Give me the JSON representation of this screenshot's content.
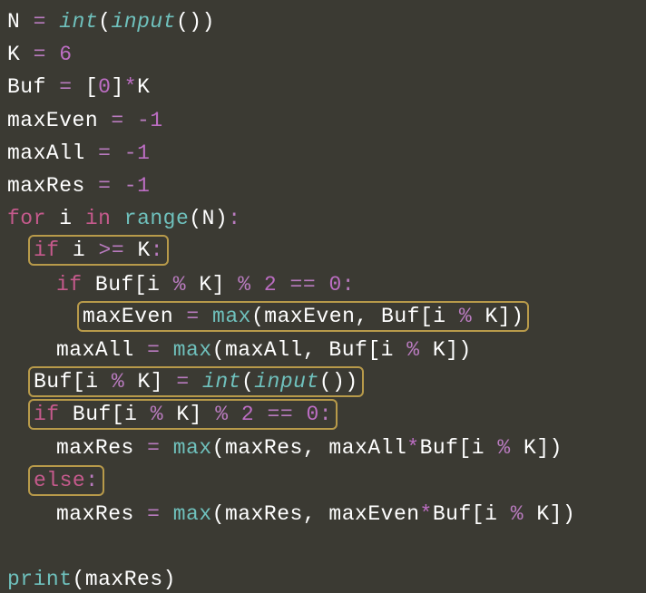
{
  "code": {
    "l1": {
      "a": "N ",
      "op1": "=",
      "b": " ",
      "fn": "int",
      "p1": "(",
      "fn2": "input",
      "p2": "(",
      "p3": ")",
      "p4": ")"
    },
    "l2": {
      "a": "K ",
      "op1": "=",
      "b": " ",
      "n": "6"
    },
    "l3": {
      "a": "Buf ",
      "op1": "=",
      "b": " ",
      "p1": "[",
      "n1": "0",
      "p2": "]",
      "star": "*",
      "c": "K"
    },
    "l4": {
      "a": "maxEven ",
      "op1": "=",
      "b": " ",
      "op2": "-",
      "n": "1"
    },
    "l5": {
      "a": "maxAll ",
      "op1": "=",
      "b": " ",
      "op2": "-",
      "n": "1"
    },
    "l6": {
      "a": "maxRes ",
      "op1": "=",
      "b": " ",
      "op2": "-",
      "n": "1"
    },
    "l7": {
      "kw1": "for",
      "a": " i ",
      "kw2": "in",
      "b": " ",
      "fn": "range",
      "p1": "(",
      "c": "N",
      "p2": ")",
      "col": ":"
    },
    "l8": {
      "kw": "if",
      "a": " i ",
      "op": ">=",
      "b": " K",
      "col": ":"
    },
    "l9": {
      "kw": "if",
      "a": " Buf",
      "p1": "[",
      "b": "i ",
      "op1": "%",
      "c": " K",
      "p2": "]",
      "d": " ",
      "op2": "%",
      "e": " ",
      "n1": "2",
      "f": " ",
      "op3": "==",
      "g": " ",
      "n2": "0",
      "col": ":"
    },
    "l10": {
      "a": "maxEven ",
      "op1": "=",
      "b": " ",
      "fn": "max",
      "p1": "(",
      "c": "maxEven",
      "cm": ",",
      "d": " Buf",
      "p2": "[",
      "e": "i ",
      "op2": "%",
      "f": " K",
      "p3": "]",
      "p4": ")"
    },
    "l11": {
      "a": "maxAll ",
      "op1": "=",
      "b": " ",
      "fn": "max",
      "p1": "(",
      "c": "maxAll",
      "cm": ",",
      "d": " Buf",
      "p2": "[",
      "e": "i ",
      "op2": "%",
      "f": " K",
      "p3": "]",
      "p4": ")"
    },
    "l12": {
      "a": "Buf",
      "p1": "[",
      "b": "i ",
      "op1": "%",
      "c": " K",
      "p2": "]",
      "d": " ",
      "op2": "=",
      "e": " ",
      "fn": "int",
      "p3": "(",
      "fn2": "input",
      "p4": "(",
      "p5": ")",
      "p6": ")"
    },
    "l13": {
      "kw": "if",
      "a": " Buf",
      "p1": "[",
      "b": "i ",
      "op1": "%",
      "c": " K",
      "p2": "]",
      "d": " ",
      "op2": "%",
      "e": " ",
      "n1": "2",
      "f": " ",
      "op3": "==",
      "g": " ",
      "n2": "0",
      "col": ":"
    },
    "l14": {
      "a": "maxRes ",
      "op1": "=",
      "b": " ",
      "fn": "max",
      "p1": "(",
      "c": "maxRes",
      "cm": ",",
      "d": " maxAll",
      "star": "*",
      "e": "Buf",
      "p2": "[",
      "f": "i ",
      "op2": "%",
      "g": " K",
      "p3": "]",
      "p4": ")"
    },
    "l15": {
      "kw": "else",
      "col": ":"
    },
    "l16": {
      "a": "maxRes ",
      "op1": "=",
      "b": " ",
      "fn": "max",
      "p1": "(",
      "c": "maxRes",
      "cm": ",",
      "d": " maxEven",
      "star": "*",
      "e": "Buf",
      "p2": "[",
      "f": "i ",
      "op2": "%",
      "g": " K",
      "p3": "]",
      "p4": ")"
    },
    "l17": "",
    "l18": {
      "fn": "print",
      "p1": "(",
      "a": "maxRes",
      "p2": ")"
    }
  }
}
